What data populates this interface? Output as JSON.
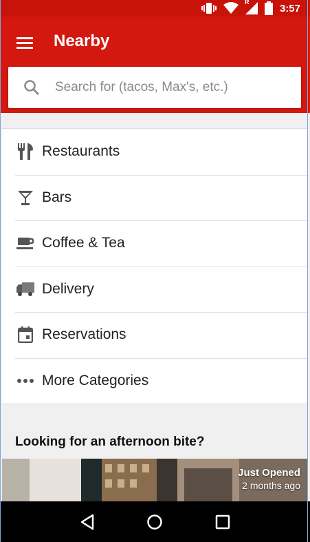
{
  "status_bar": {
    "time": "3:57",
    "icons": [
      "vibrate-icon",
      "wifi-icon",
      "signal-roaming-icon",
      "battery-icon"
    ],
    "roaming_marker": "R"
  },
  "app_bar": {
    "menu_icon": "hamburger-menu-icon",
    "title": "Nearby",
    "background_color": "#d4180f"
  },
  "search": {
    "icon": "search-icon",
    "placeholder": "Search for (tacos, Max's, etc.)"
  },
  "categories": [
    {
      "label": "Restaurants",
      "icon": "fork-knife-icon"
    },
    {
      "label": "Bars",
      "icon": "cocktail-glass-icon"
    },
    {
      "label": "Coffee & Tea",
      "icon": "coffee-cup-icon"
    },
    {
      "label": "Delivery",
      "icon": "delivery-truck-icon"
    },
    {
      "label": "Reservations",
      "icon": "calendar-icon"
    },
    {
      "label": "More Categories",
      "icon": "more-dots-icon"
    }
  ],
  "section": {
    "title": "Looking for an afternoon bite?",
    "card": {
      "badge_title": "Just Opened",
      "badge_subtitle": "2 months ago"
    }
  },
  "nav_bar": {
    "buttons": [
      "back-icon",
      "home-icon",
      "recents-icon"
    ]
  }
}
